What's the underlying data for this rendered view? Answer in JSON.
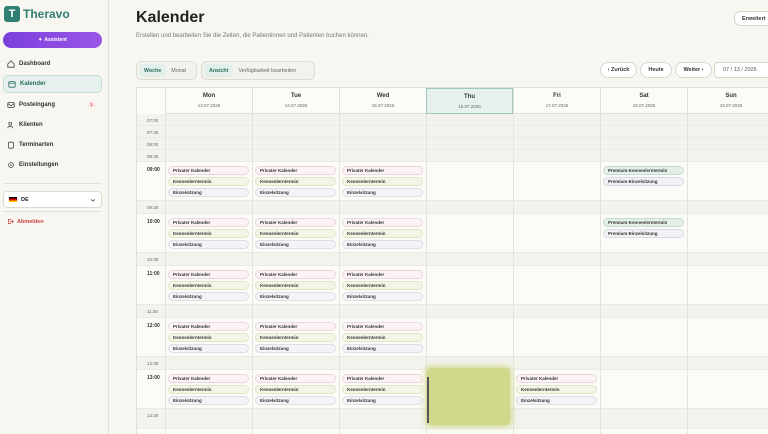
{
  "brand": {
    "name": "Theravo",
    "logo_letter": "T"
  },
  "assistant_label": "Assistent",
  "nav": [
    {
      "label": "Dashboard",
      "icon": "home-icon"
    },
    {
      "label": "Kalender",
      "icon": "calendar-icon",
      "active": true
    },
    {
      "label": "Posteingang",
      "icon": "inbox-icon",
      "badge": "1"
    },
    {
      "label": "Klienten",
      "icon": "users-icon"
    },
    {
      "label": "Terminarten",
      "icon": "clipboard-icon"
    },
    {
      "label": "Einstellungen",
      "icon": "gear-icon"
    }
  ],
  "language": "DE",
  "logout_label": "Abmelden",
  "header": {
    "title": "Kalender",
    "subtitle": "Erstellen und bearbeiten Sie die Zeiten, die Patientinnen und Patienten buchen können.",
    "extended_label": "Erweitert"
  },
  "toolbar": {
    "view_week": "Woche",
    "view_month": "Monat",
    "mode_view": "Ansicht",
    "mode_edit": "Verfügbarkeit bearbeiten",
    "prev": "‹ Zurück",
    "today": "Heute",
    "next": "Weiter ›",
    "date": "07 / 13 / 2026"
  },
  "days": [
    {
      "name": "Mon",
      "date": "13.07.2026"
    },
    {
      "name": "Tue",
      "date": "14.07.2026"
    },
    {
      "name": "Wed",
      "date": "15.07.2026"
    },
    {
      "name": "Thu",
      "date": "16.07.2026",
      "today": true
    },
    {
      "name": "Fri",
      "date": "17.07.2026"
    },
    {
      "name": "Sat",
      "date": "18.07.2026"
    },
    {
      "name": "Sun",
      "date": "19.07.2026"
    }
  ],
  "times": [
    "07:00",
    "07:30",
    "08:00",
    "08:30",
    "09:00",
    "09:30",
    "10:00",
    "10:30",
    "11:00",
    "11:30",
    "12:00",
    "12:30",
    "13:00",
    "13:30"
  ],
  "event_labels": {
    "private": "Privater Kalender",
    "intro": "Kennenlerntermin",
    "single": "Einzelsitzung",
    "premium_intro": "Premium-Kennenlerntermin",
    "premium_single": "Premium-Einzelsitzung"
  },
  "colors": {
    "accent": "#2f7f73",
    "assistant": "#8a4ae0",
    "logout": "#c9413b",
    "today_bg": "#e6f1ed"
  }
}
